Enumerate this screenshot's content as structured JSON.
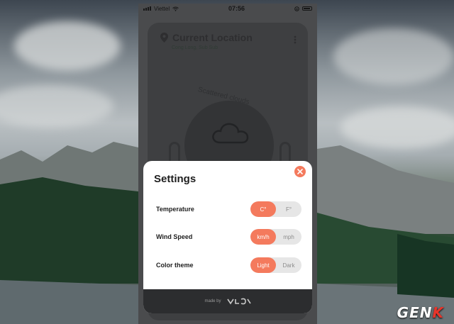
{
  "status_bar": {
    "carrier": "Viettel",
    "time": "07:56"
  },
  "weather": {
    "location_title": "Current Location",
    "location_subtitle": "Cong Long, Sub Sub",
    "condition": "Scattered clouds"
  },
  "settings": {
    "title": "Settings",
    "rows": [
      {
        "label": "Temperature",
        "options": [
          "C°",
          "F°"
        ],
        "selected": "C°"
      },
      {
        "label": "Wind Speed",
        "options": [
          "km/h",
          "mph"
        ],
        "selected": "km/h"
      },
      {
        "label": "Color theme",
        "options": [
          "Light",
          "Dark"
        ],
        "selected": "Light"
      }
    ],
    "footer_text": "made by"
  },
  "watermark": {
    "text_main": "GEN",
    "text_accent": "K"
  },
  "colors": {
    "accent": "#f47a5d",
    "toggle_bg": "#e6e6e6",
    "footer_bg": "#2c2d2f"
  }
}
